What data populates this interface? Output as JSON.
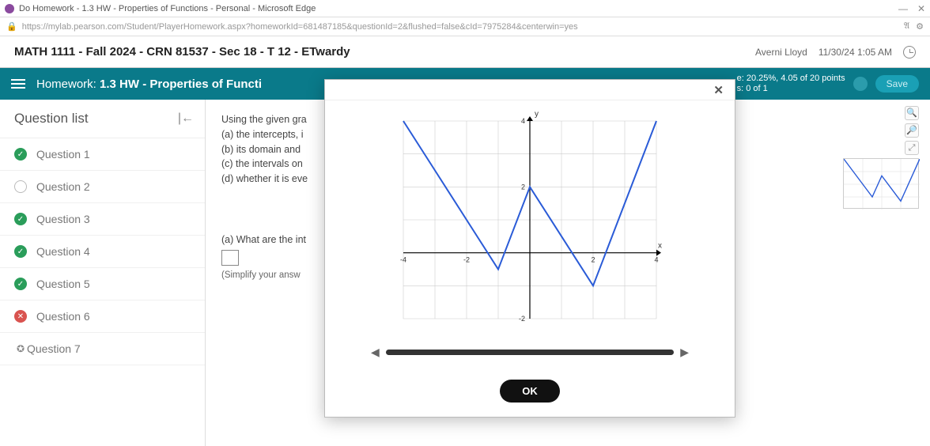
{
  "window": {
    "title": "Do Homework - 1.3 HW - Properties of Functions - Personal - Microsoft Edge",
    "url": "https://mylab.pearson.com/Student/PlayerHomework.aspx?homeworkId=681487185&questionId=2&flushed=false&cId=7975284&centerwin=yes"
  },
  "course": {
    "title": "MATH 1111 - Fall 2024 - CRN 81537 - Sec 18 - T 12 - ETwardy",
    "user": "Averni Lloyd",
    "datetime": "11/30/24 1:05 AM"
  },
  "banner": {
    "prefix": "Homework:",
    "title": "1.3 HW - Properties of Functi",
    "score_line1": "e: 20.25%, 4.05 of 20 points",
    "score_line2": "s: 0 of 1",
    "save": "Save"
  },
  "sidebar": {
    "header": "Question list",
    "items": [
      {
        "label": "Question 1",
        "status": "done"
      },
      {
        "label": "Question 2",
        "status": "open"
      },
      {
        "label": "Question 3",
        "status": "done"
      },
      {
        "label": "Question 4",
        "status": "done"
      },
      {
        "label": "Question 5",
        "status": "done"
      },
      {
        "label": "Question 6",
        "status": "wrong"
      },
      {
        "label": "Question 7",
        "status": "partial"
      }
    ]
  },
  "stem": {
    "intro": "Using the given gra",
    "a": "(a)  the intercepts, i",
    "b": "(b)  its domain and",
    "c": "(c)  the intervals on",
    "d": "(d)  whether it is eve"
  },
  "partA": {
    "prompt": "(a) What are the int",
    "note": "(Simplify your answ"
  },
  "modal": {
    "ok": "OK",
    "y_label": "y",
    "x_label": "x"
  },
  "chart_data": {
    "type": "line",
    "title": "",
    "xlabel": "x",
    "ylabel": "y",
    "xlim": [
      -4,
      4
    ],
    "ylim": [
      -2,
      4
    ],
    "x": [
      -4,
      -3,
      -2,
      -1,
      0,
      1,
      2,
      3,
      4
    ],
    "y": [
      4,
      2.5,
      1,
      -0.5,
      2,
      0.5,
      -1,
      1.5,
      4
    ],
    "xticks": [
      -4,
      -2,
      2,
      4
    ],
    "yticks": [
      -2,
      2,
      4
    ]
  }
}
